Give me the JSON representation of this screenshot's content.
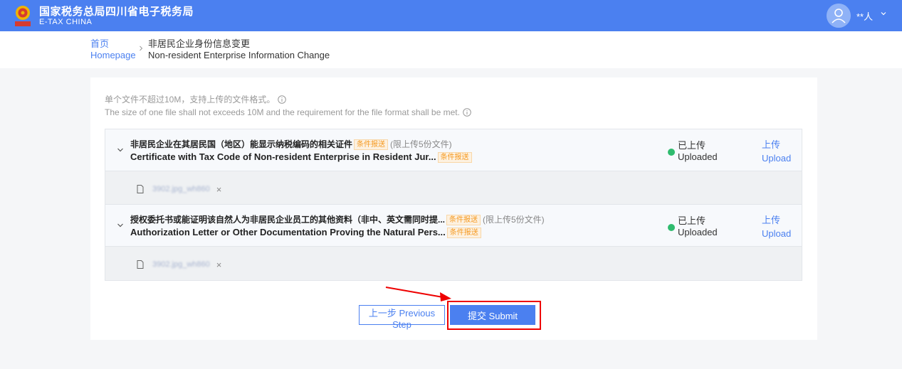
{
  "header": {
    "title_cn": "国家税务总局四川省电子税务局",
    "title_en": "E-TAX  CHINA",
    "user_name": "**人"
  },
  "breadcrumb": {
    "home_cn": "首页",
    "home_en": "Homepage",
    "current_cn": "非居民企业身份信息变更",
    "current_en": "Non-resident Enterprise Information Change"
  },
  "hints": {
    "cn": "单个文件不超过10M，支持上传的文件格式。",
    "en": "The size of one file shall not exceeds 10M and the requirement for the file format shall be met."
  },
  "sections": [
    {
      "title_cn": "非居民企业在其居民国（地区）能显示纳税编码的相关证件",
      "title_en": "Certificate with Tax Code of Non-resident Enterprise in Resident Jur...",
      "tag": "条件报送",
      "limit": "(限上传5份文件)",
      "status_cn": "已上传",
      "status_en": "Uploaded",
      "upload_cn": "上传",
      "upload_en": "Upload",
      "file": "3902.jpg_wh860",
      "remove": "×"
    },
    {
      "title_cn": "授权委托书或能证明该自然人为非居民企业员工的其他资料（非中、英文需同时提...",
      "title_en": "Authorization Letter or Other Documentation Proving the Natural Pers...",
      "tag": "条件报送",
      "limit": "(限上传5份文件)",
      "status_cn": "已上传",
      "status_en": "Uploaded",
      "upload_cn": "上传",
      "upload_en": "Upload",
      "file": "3902.jpg_wh860",
      "remove": "×"
    }
  ],
  "buttons": {
    "prev": "上一步 Previous Step",
    "submit": "提交 Submit"
  },
  "colors": {
    "primary": "#4b80f0",
    "tag": "#f59a23",
    "success": "#2fbb6e",
    "highlight": "#ee0000"
  }
}
